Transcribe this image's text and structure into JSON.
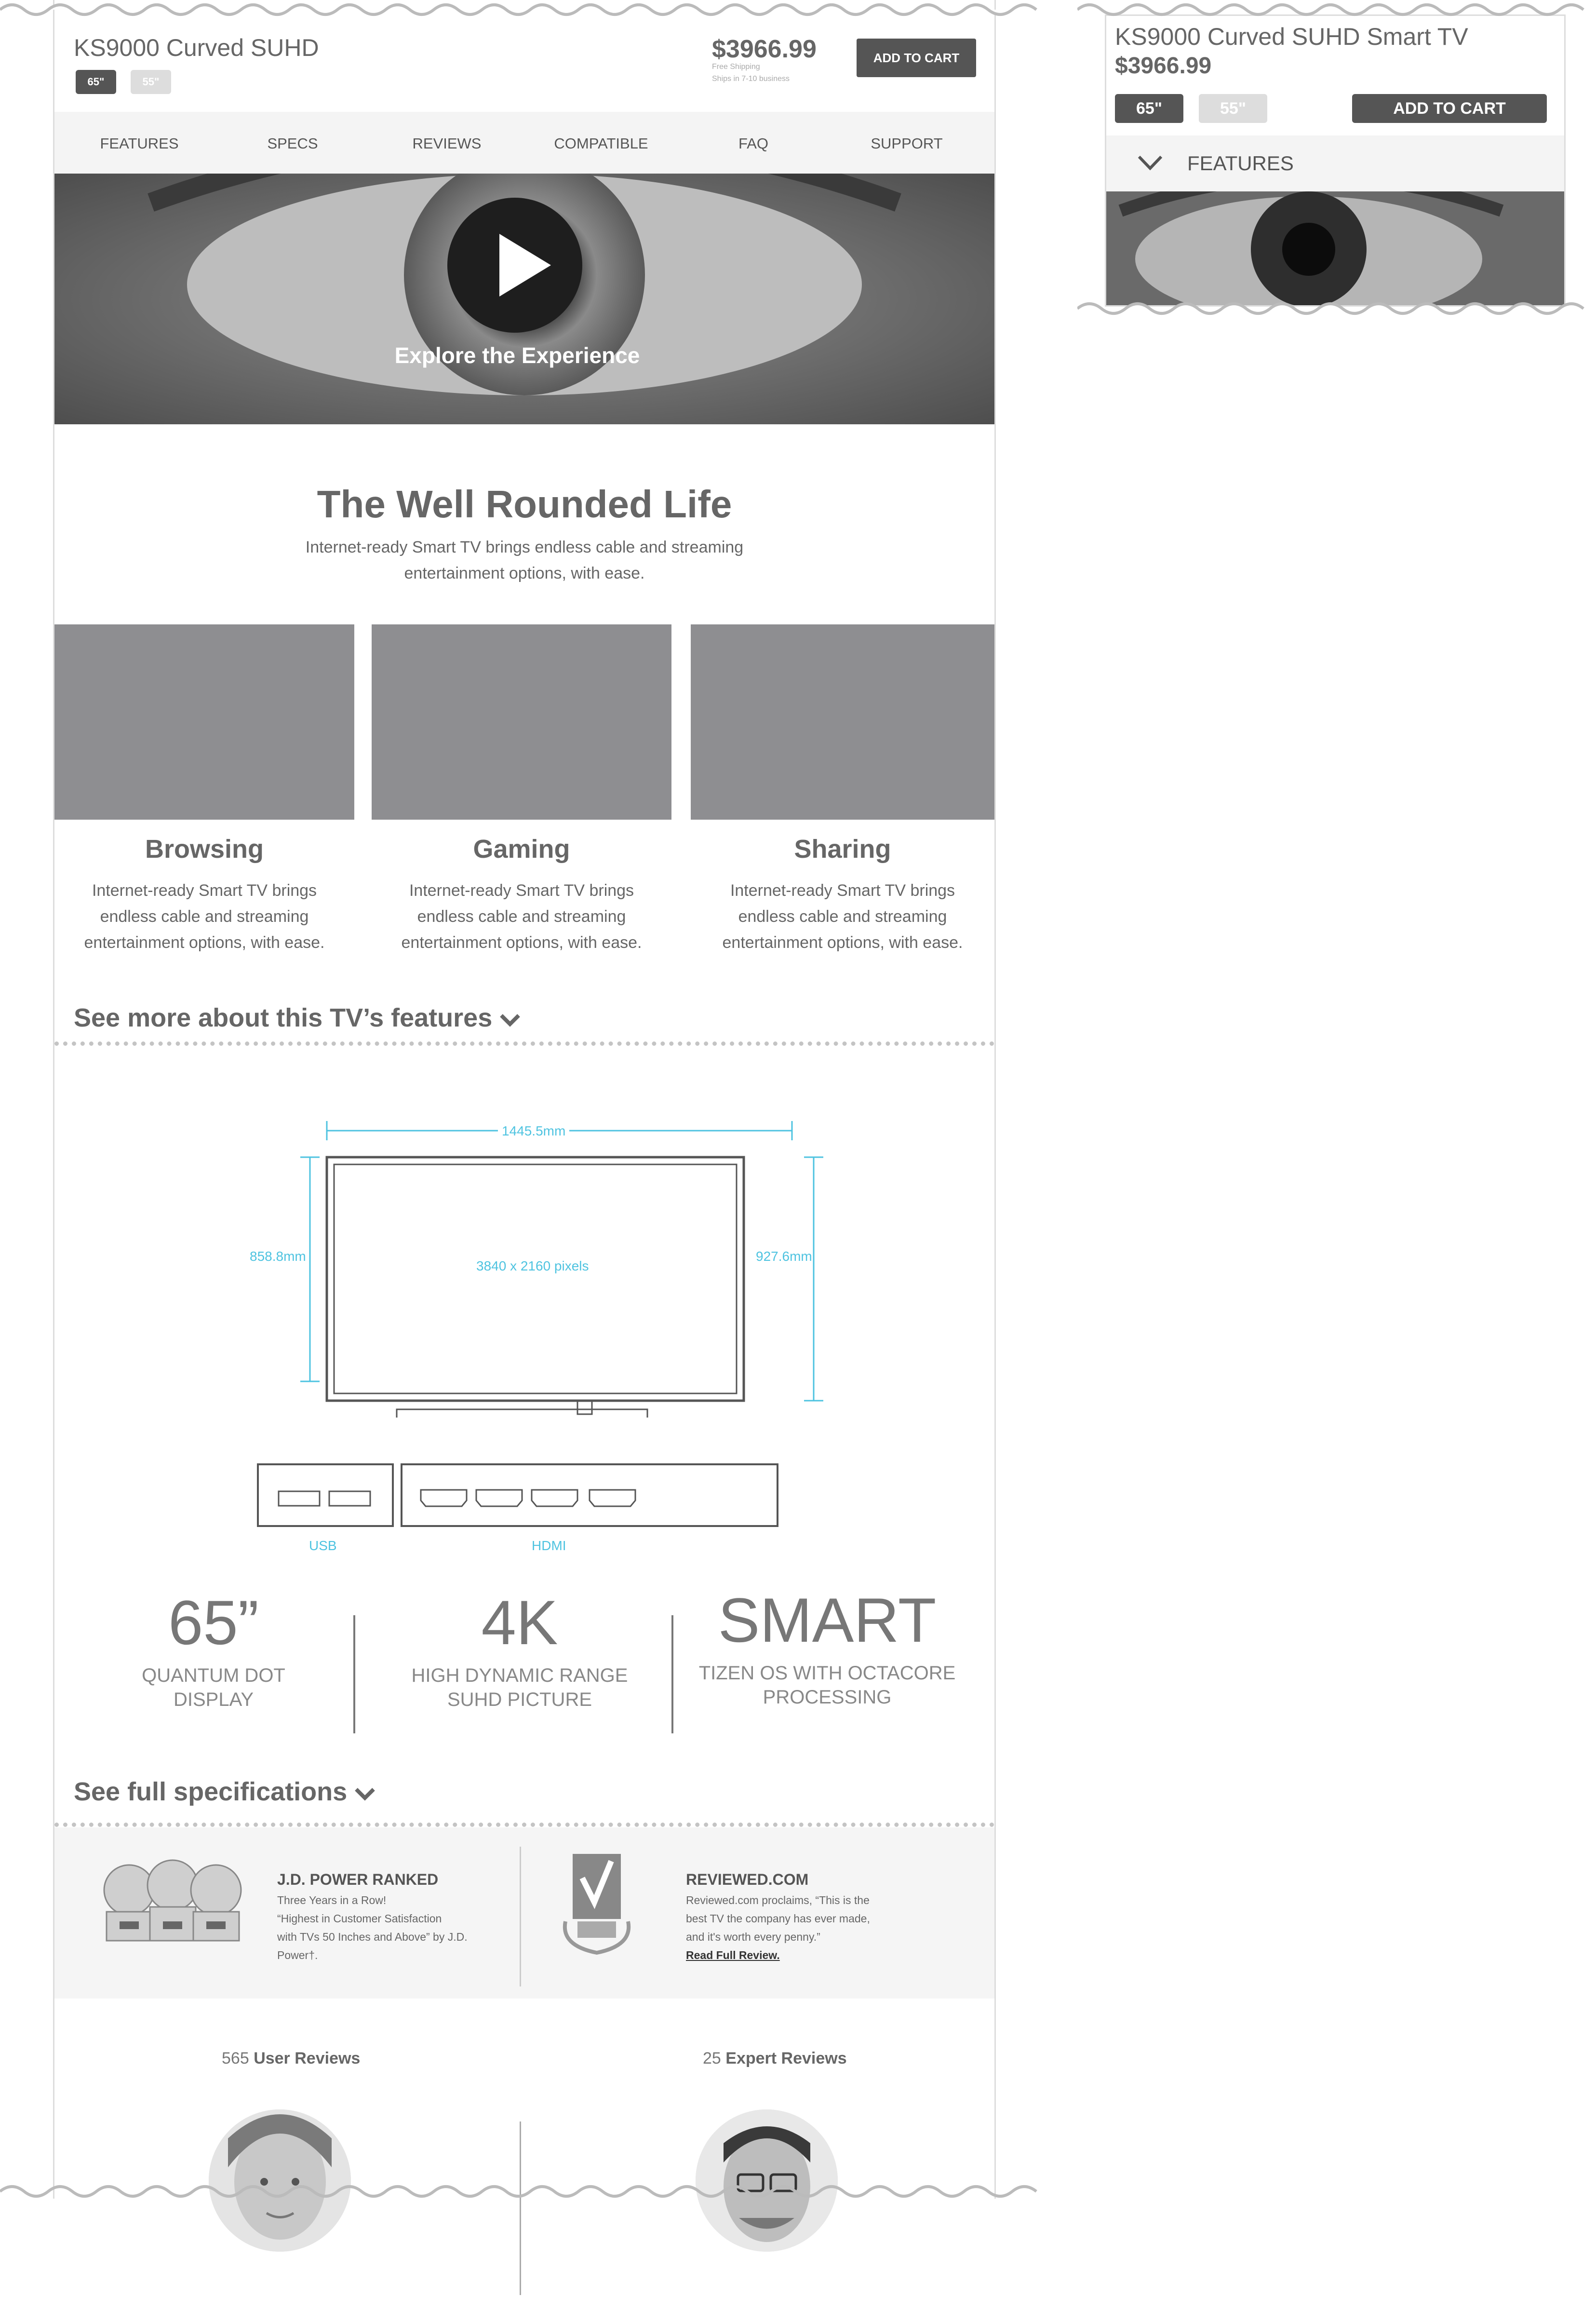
{
  "product": {
    "title": "KS9000 Curved SUHD",
    "price": "$3966.99",
    "shipping_line1": "Free Shipping",
    "shipping_line2": "Ships in 7-10 business",
    "sizes": [
      "65\"",
      "55\""
    ],
    "selected_size": "65\"",
    "add_to_cart": "ADD TO CART"
  },
  "nav": [
    "FEATURES",
    "SPECS",
    "REVIEWS",
    "COMPATIBLE",
    "FAQ",
    "SUPPORT"
  ],
  "hero": {
    "caption": "Explore the Experience"
  },
  "intro": {
    "title": "The Well Rounded Life",
    "body_line1": "Internet-ready Smart TV brings endless cable and streaming",
    "body_line2": "entertainment options, with ease."
  },
  "features": [
    {
      "title": "Browsing",
      "l1": "Internet-ready Smart TV brings",
      "l2": "endless cable and streaming",
      "l3": "entertainment options, with ease."
    },
    {
      "title": "Gaming",
      "l1": "Internet-ready Smart TV brings",
      "l2": "endless cable and streaming",
      "l3": "entertainment options, with ease."
    },
    {
      "title": "Sharing",
      "l1": "Internet-ready Smart TV brings",
      "l2": "endless cable and streaming",
      "l3": "entertainment options, with ease."
    }
  ],
  "see_more": "See more about this TV’s features",
  "diagram": {
    "width": "1445.5mm",
    "height_left": "858.8mm",
    "height_right": "927.6mm",
    "resolution": "3840 x 2160 pixels",
    "usb": "USB",
    "hdmi": "HDMI"
  },
  "stats": [
    {
      "big": "65”",
      "l1": "QUANTUM DOT",
      "l2": "DISPLAY"
    },
    {
      "big": "4K",
      "l1": "HIGH DYNAMIC RANGE",
      "l2": "SUHD PICTURE"
    },
    {
      "big": "SMART",
      "l1": "TIZEN OS WITH OCTACORE",
      "l2": "PROCESSING"
    }
  ],
  "see_specs": "See full specifications",
  "awards": {
    "jd": {
      "title": "J.D. POWER RANKED",
      "l1": "Three Years in a Row!",
      "l2": "“Highest in Customer Satisfaction",
      "l3": "with TVs 50 Inches and Above” by J.D.",
      "l4": "Power†."
    },
    "rv": {
      "title": "REVIEWED.COM",
      "l1": "Reviewed.com proclaims, “This is the",
      "l2": "best TV the company has ever made,",
      "l3": "and it's worth every penny.”",
      "link": "Read Full Review."
    }
  },
  "reviews": {
    "user_count": "565",
    "user_label": "User Reviews",
    "expert_count": "25",
    "expert_label": "Expert Reviews"
  },
  "mobile": {
    "title": "KS9000 Curved SUHD Smart TV",
    "price": "$3966.99",
    "sizes": [
      "65\"",
      "55\""
    ],
    "add_to_cart": "ADD TO CART",
    "section": "FEATURES"
  }
}
